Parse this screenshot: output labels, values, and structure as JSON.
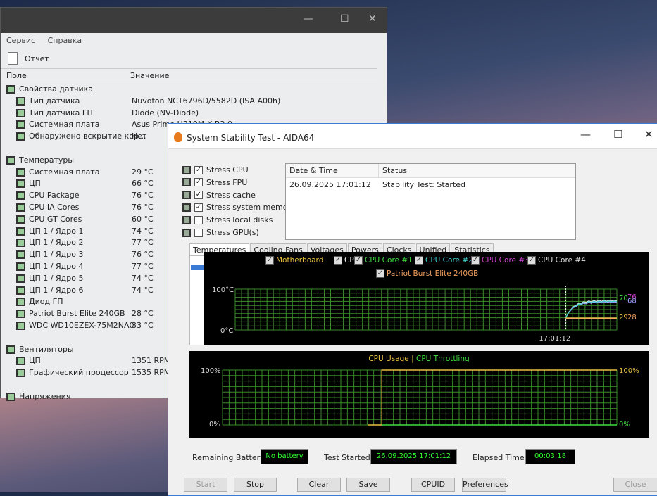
{
  "main_window": {
    "window_controls": [
      "—",
      "☐",
      "✕"
    ],
    "menu": [
      "Сервис",
      "Справка"
    ],
    "toolbar": {
      "report": "Отчёт"
    },
    "columns": {
      "field": "Поле",
      "value": "Значение"
    },
    "rows": [
      {
        "label": "Свойства датчика",
        "value": "",
        "indent": 0,
        "icon": "sensor-icon"
      },
      {
        "label": "Тип датчика",
        "value": "Nuvoton NCT6796D/5582D  (ISA A00h)",
        "indent": 1,
        "icon": "sensor-icon"
      },
      {
        "label": "Тип датчика ГП",
        "value": "Diode  (NV-Diode)",
        "indent": 1,
        "icon": "gpu-icon"
      },
      {
        "label": "Системная плата",
        "value": "Asus Prime H310M-K R2.0",
        "indent": 1,
        "icon": "motherboard-icon"
      },
      {
        "label": "Обнаружено вскрытие кор...",
        "value": "Нет",
        "indent": 1,
        "icon": "shield-icon"
      },
      {
        "label": "",
        "value": "",
        "indent": 0,
        "icon": ""
      },
      {
        "label": "Температуры",
        "value": "",
        "indent": 0,
        "icon": "thermometer-icon"
      },
      {
        "label": "Системная плата",
        "value": "29 °C",
        "indent": 1,
        "icon": "motherboard-icon"
      },
      {
        "label": "ЦП",
        "value": "66 °C",
        "indent": 1,
        "icon": "cpu-icon"
      },
      {
        "label": "CPU Package",
        "value": "76 °C",
        "indent": 1,
        "icon": "cpu-icon"
      },
      {
        "label": "CPU IA Cores",
        "value": "76 °C",
        "indent": 1,
        "icon": "cpu-icon"
      },
      {
        "label": "CPU GT Cores",
        "value": "60 °C",
        "indent": 1,
        "icon": "gpu-icon"
      },
      {
        "label": "ЦП 1 / Ядро 1",
        "value": "74 °C",
        "indent": 1,
        "icon": "cpu-icon"
      },
      {
        "label": "ЦП 1 / Ядро 2",
        "value": "77 °C",
        "indent": 1,
        "icon": "cpu-icon"
      },
      {
        "label": "ЦП 1 / Ядро 3",
        "value": "76 °C",
        "indent": 1,
        "icon": "cpu-icon"
      },
      {
        "label": "ЦП 1 / Ядро 4",
        "value": "77 °C",
        "indent": 1,
        "icon": "cpu-icon"
      },
      {
        "label": "ЦП 1 / Ядро 5",
        "value": "74 °C",
        "indent": 1,
        "icon": "cpu-icon"
      },
      {
        "label": "ЦП 1 / Ядро 6",
        "value": "74 °C",
        "indent": 1,
        "icon": "cpu-icon"
      },
      {
        "label": "Диод ГП",
        "value": "",
        "indent": 1,
        "icon": "gpu-icon"
      },
      {
        "label": "Patriot Burst Elite 240GB",
        "value": "28 °C",
        "indent": 1,
        "icon": "disk-icon"
      },
      {
        "label": "WDC WD10EZEX-75M2NA0",
        "value": "33 °C",
        "indent": 1,
        "icon": "disk-icon"
      },
      {
        "label": "",
        "value": "",
        "indent": 0,
        "icon": ""
      },
      {
        "label": "Вентиляторы",
        "value": "",
        "indent": 0,
        "icon": "fan-icon"
      },
      {
        "label": "ЦП",
        "value": "1351 RPM",
        "indent": 1,
        "icon": "cpu-icon"
      },
      {
        "label": "Графический процессор",
        "value": "1535 RPM",
        "indent": 1,
        "icon": "gpu-icon"
      },
      {
        "label": "",
        "value": "",
        "indent": 0,
        "icon": ""
      },
      {
        "label": "Напряжения",
        "value": "",
        "indent": 0,
        "icon": "voltage-icon"
      }
    ]
  },
  "stability": {
    "title": "System Stability Test - AIDA64",
    "window_controls": [
      "—",
      "☐",
      "✕"
    ],
    "stress": [
      {
        "label": "Stress CPU",
        "checked": true
      },
      {
        "label": "Stress FPU",
        "checked": true
      },
      {
        "label": "Stress cache",
        "checked": true
      },
      {
        "label": "Stress system memory",
        "checked": true
      },
      {
        "label": "Stress local disks",
        "checked": false
      },
      {
        "label": "Stress GPU(s)",
        "checked": false
      }
    ],
    "status_table": {
      "headers": [
        "Date & Time",
        "Status"
      ],
      "rows": [
        [
          "26.09.2025 17:01:12",
          "Stability Test: Started"
        ]
      ]
    },
    "tabs": [
      "Temperatures",
      "Cooling Fans",
      "Voltages",
      "Powers",
      "Clocks",
      "Unified",
      "Statistics"
    ],
    "active_tab": "Temperatures",
    "footer": {
      "battery_label": "Remaining Battery:",
      "battery_value": "No battery",
      "started_label": "Test Started:",
      "started_value": "26.09.2025 17:01:12",
      "elapsed_label": "Elapsed Time:",
      "elapsed_value": "00:03:18"
    },
    "buttons": [
      "Start",
      "Stop",
      "Clear",
      "Save",
      "CPUID",
      "Preferences",
      "Close"
    ]
  },
  "chart_data": [
    {
      "type": "line",
      "ylim": [
        0,
        100
      ],
      "y_top_label": "100°C",
      "y_bottom_label": "0°C",
      "x_marker": "17:01:12",
      "grid": true,
      "legend": [
        {
          "name": "Motherboard",
          "color": "#e8c040"
        },
        {
          "name": "CPU",
          "color": "#ffffff"
        },
        {
          "name": "CPU Core #1",
          "color": "#40e040"
        },
        {
          "name": "CPU Core #2",
          "color": "#40d0d0"
        },
        {
          "name": "CPU Core #3",
          "color": "#d040d0"
        },
        {
          "name": "CPU Core #4",
          "color": "#e0e0e0"
        },
        {
          "name": "Patriot Burst Elite 240GB",
          "color": "#f0a060"
        }
      ],
      "end_labels": [
        {
          "value": "70",
          "color": "#40e040"
        },
        {
          "value": "76",
          "color": "#d040d0"
        },
        {
          "value": "68",
          "color": "#a0a0ff"
        },
        {
          "value": "29",
          "color": "#e8c040"
        },
        {
          "value": "28",
          "color": "#f0a060"
        }
      ]
    },
    {
      "type": "line",
      "ylim": [
        0,
        100
      ],
      "y_top_label": "100%",
      "y_bottom_label": "0%",
      "grid": true,
      "legend": [
        {
          "name": "CPU Usage",
          "color": "#e8c040"
        },
        {
          "name": "CPU Throttling",
          "color": "#40e040"
        }
      ],
      "separator": "|",
      "series": [
        {
          "name": "CPU Usage",
          "before_start": 0,
          "after_start": 100
        },
        {
          "name": "CPU Throttling",
          "value": 0
        }
      ]
    }
  ]
}
